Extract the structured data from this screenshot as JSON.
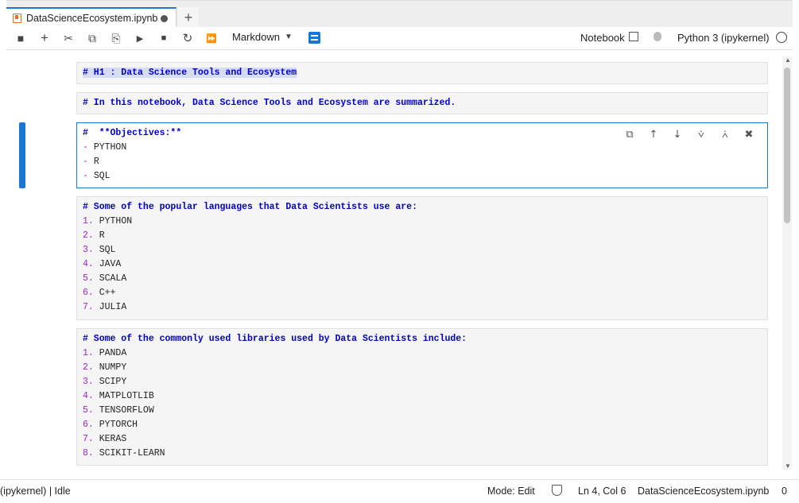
{
  "tab": {
    "title": "DataScienceEcosystem.ipynb",
    "new_tab": "+"
  },
  "toolbar": {
    "save": "■",
    "insert": "+",
    "cut": "✂",
    "copy": "⧉",
    "paste": "⎘",
    "run": "▶",
    "stop": "■",
    "restart": "↻",
    "run_all": "⏩",
    "cell_type": "Markdown",
    "notebook_label": "Notebook",
    "kernel_name": "Python 3 (ipykernel)"
  },
  "cells": [
    {
      "lines": [
        {
          "num": "",
          "text": "# H1 : Data Science Tools and Ecosystem",
          "kind": "hdr-hl"
        }
      ]
    },
    {
      "lines": [
        {
          "num": "",
          "text": "# In this notebook, Data Science Tools and Ecosystem are summarized.",
          "kind": "hdr"
        }
      ]
    },
    {
      "lines": [
        {
          "num": "",
          "text": "#  **Objectives:**",
          "kind": "hdr"
        },
        {
          "num": "- ",
          "text": "PYTHON",
          "kind": "item"
        },
        {
          "num": "- ",
          "text": "R",
          "kind": "item"
        },
        {
          "num": "- ",
          "text": "SQL",
          "kind": "item"
        }
      ]
    },
    {
      "lines": [
        {
          "num": "",
          "text": "# Some of the popular languages that Data Scientists use are:",
          "kind": "hdr"
        },
        {
          "num": "1. ",
          "text": "PYTHON",
          "kind": "item"
        },
        {
          "num": "2. ",
          "text": "R",
          "kind": "item"
        },
        {
          "num": "3. ",
          "text": "SQL",
          "kind": "item"
        },
        {
          "num": "4. ",
          "text": "JAVA",
          "kind": "item"
        },
        {
          "num": "5. ",
          "text": "SCALA",
          "kind": "item"
        },
        {
          "num": "6. ",
          "text": "C++",
          "kind": "item"
        },
        {
          "num": "7. ",
          "text": "JULIA",
          "kind": "item"
        }
      ]
    },
    {
      "lines": [
        {
          "num": "",
          "text": "# Some of the commonly used libraries used by Data Scientists include:",
          "kind": "hdr"
        },
        {
          "num": "1. ",
          "text": "PANDA",
          "kind": "item"
        },
        {
          "num": "2. ",
          "text": "NUMPY",
          "kind": "item"
        },
        {
          "num": "3. ",
          "text": "SCIPY",
          "kind": "item"
        },
        {
          "num": "4. ",
          "text": "MATPLOTLIB",
          "kind": "item"
        },
        {
          "num": "5. ",
          "text": "TENSORFLOW",
          "kind": "item"
        },
        {
          "num": "6. ",
          "text": "PYTORCH",
          "kind": "item"
        },
        {
          "num": "7. ",
          "text": "KERAS",
          "kind": "item"
        },
        {
          "num": "8. ",
          "text": "SCIKIT-LEARN",
          "kind": "item"
        }
      ]
    }
  ],
  "cell_tools": {
    "duplicate": "⧉",
    "move_up": "↑",
    "move_down": "↓",
    "insert_above": "⩒",
    "insert_below": "⩑",
    "delete": "✖"
  },
  "status": {
    "kernel": "(ipykernel) | Idle",
    "mode": "Mode: Edit",
    "position": "Ln 4, Col 6",
    "filename": "DataScienceEcosystem.ipynb",
    "notifications": "0"
  },
  "colors": {
    "accent": "#1976d2",
    "header_text": "#0000c8",
    "list_number": "#a025c8"
  }
}
